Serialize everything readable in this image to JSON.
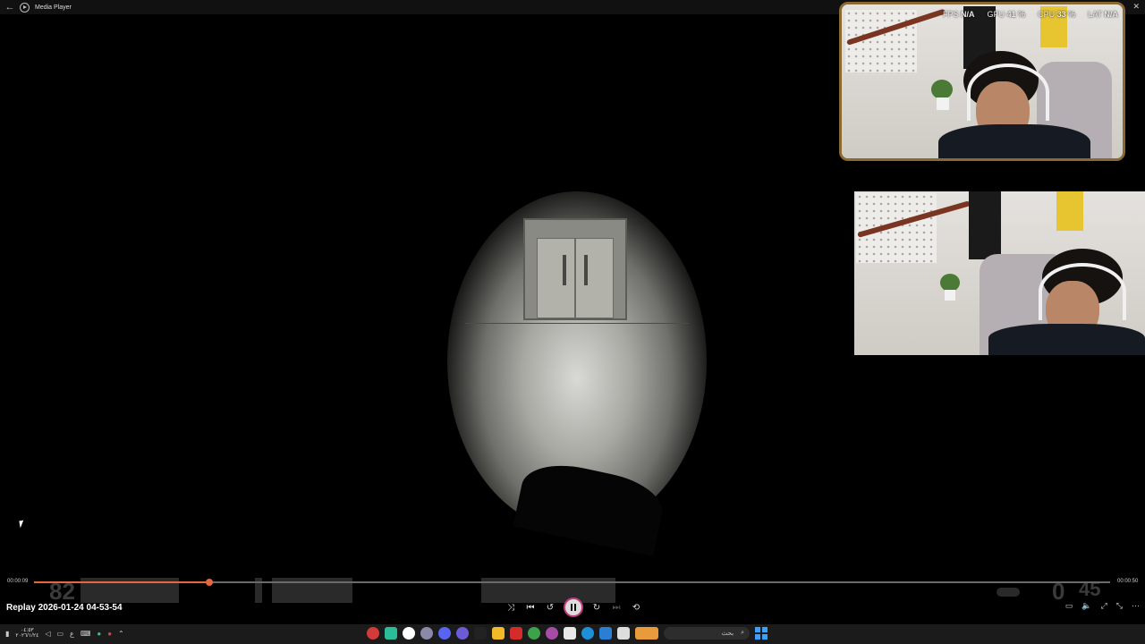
{
  "window": {
    "title": "Media Player",
    "back_glyph": "←",
    "controls": [
      "–",
      "▢",
      "✕"
    ]
  },
  "stats": [
    {
      "label": "FPS",
      "value": "N/A"
    },
    {
      "label": "GPU",
      "value": "41 %"
    },
    {
      "label": "CPU",
      "value": "33 %"
    },
    {
      "label": "LAT",
      "value": "N/A"
    }
  ],
  "hud": {
    "health": "82",
    "ammo": "0",
    "reserve": "45"
  },
  "player": {
    "replay_title": "Replay 2026-01-24 04-53-54",
    "current_time": "00:00:09",
    "total_time": "00:00:50",
    "progress_fraction": 0.163,
    "accent_color": "#e8663c"
  },
  "controls": {
    "shuffle": "⤨",
    "previous": "⏮",
    "rewind": "↺",
    "forward": "↻",
    "next": "⏭",
    "repeat": "⟲"
  },
  "right_controls": [
    "▭",
    "🔈",
    "⤢",
    "⤡",
    "⋯"
  ],
  "taskbar": {
    "date_line1": "٠٤:٥٣",
    "date_line2": "٢٠٢٦/١/٢٤",
    "search_text": "بحث",
    "search_icon": "⌕"
  }
}
